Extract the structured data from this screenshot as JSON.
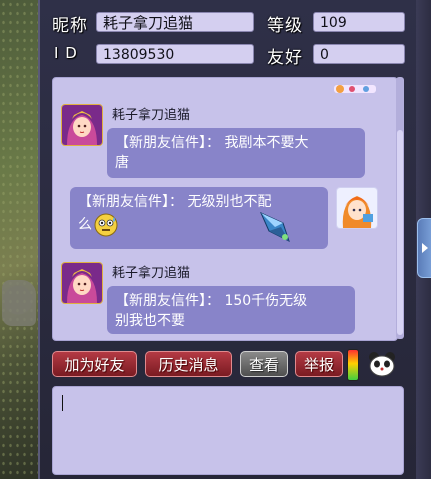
{
  "profile": {
    "nickname_label": "昵称",
    "nickname_value": "耗子拿刀追猫",
    "level_label": "等级",
    "level_value": "109",
    "id_label": "I D",
    "id_value": "13809530",
    "friendship_label": "友好",
    "friendship_value": "0"
  },
  "messages": [
    {
      "sender": "耗子拿刀追猫",
      "text": "【新朋友信件】：我剧本不要大唐",
      "line1": "【新朋友信件】：  我剧本不要大",
      "line2": "唐"
    },
    {
      "sender": "",
      "line1": "【新朋友信件】：  无级别也不配",
      "line2": "么"
    },
    {
      "sender": "耗子拿刀追猫",
      "line1": "【新朋友信件】：  150千伤无级",
      "line2": "别我也不要"
    }
  ],
  "buttons": {
    "add_friend": "加为好友",
    "history": "历史消息",
    "view": "查看",
    "report": "举报"
  },
  "input": {
    "value": ""
  },
  "colors": {
    "panel_bg": "#2f3048",
    "chat_bg": "#c7c2ea",
    "bubble_bg": "#8884c9",
    "button_red": "#9a2a33"
  },
  "icons": {
    "emoji": "sweating-face-icon",
    "gem": "blue-gem-icon",
    "bear": "panda-bear-icon"
  }
}
